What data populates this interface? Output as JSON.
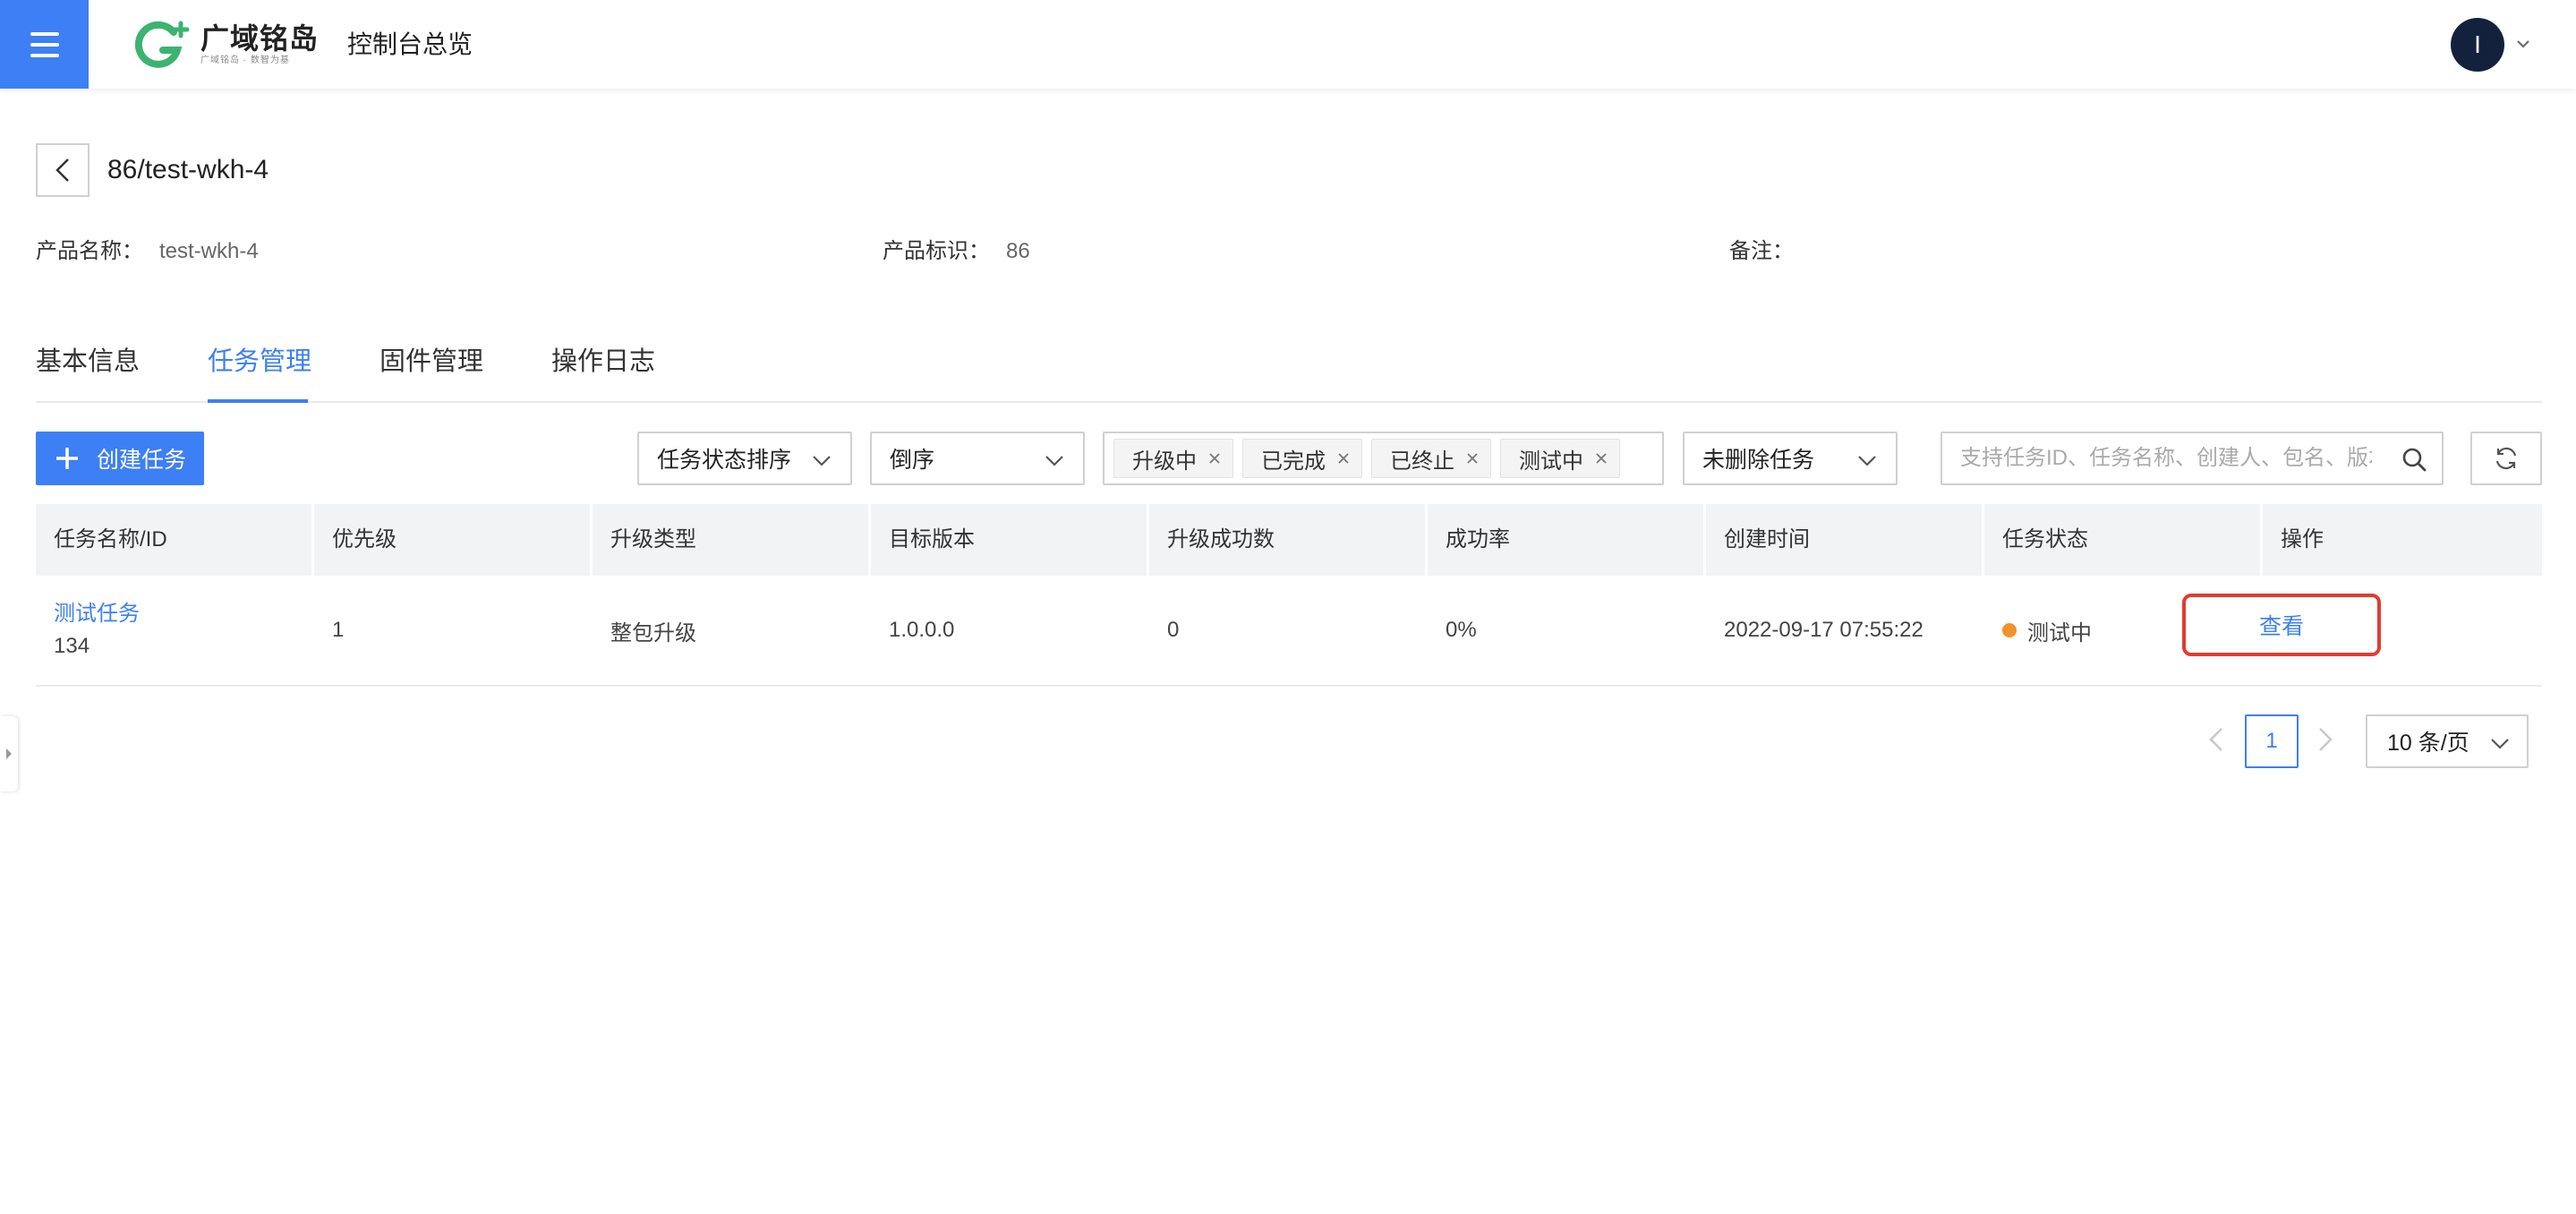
{
  "header": {
    "brand_name": "广域铭岛",
    "brand_tagline": "广域铭岛 · 数智为基",
    "console_title": "控制台总览",
    "avatar_letter": "I",
    "accent_color": "#3d7ff4"
  },
  "breadcrumb": {
    "title": "86/test-wkh-4"
  },
  "product_info": {
    "name_label": "产品名称：",
    "name_value": "test-wkh-4",
    "key_label": "产品标识：",
    "key_value": "86",
    "remark_label": "备注：",
    "remark_value": ""
  },
  "tabs": [
    {
      "label": "基本信息",
      "active": false
    },
    {
      "label": "任务管理",
      "active": true
    },
    {
      "label": "固件管理",
      "active": false
    },
    {
      "label": "操作日志",
      "active": false
    }
  ],
  "toolbar": {
    "create_label": "创建任务",
    "sort_field": "任务状态排序",
    "sort_order": "倒序",
    "status_tags": [
      "升级中",
      "已完成",
      "已终止",
      "测试中"
    ],
    "delete_filter": "未删除任务",
    "search_placeholder": "支持任务ID、任务名称、创建人、包名、版本"
  },
  "table": {
    "columns": [
      "任务名称/ID",
      "优先级",
      "升级类型",
      "目标版本",
      "升级成功数",
      "成功率",
      "创建时间",
      "任务状态",
      "操作"
    ],
    "rows": [
      {
        "task_name": "测试任务",
        "task_id": "134",
        "priority": "1",
        "upgrade_type": "整包升级",
        "target_version": "1.0.0.0",
        "success_count": "0",
        "success_rate": "0%",
        "created_at": "2022-09-17 07:55:22",
        "status": "测试中",
        "status_color": "#f0932b",
        "action": "查看"
      }
    ]
  },
  "pagination": {
    "current_page": "1",
    "page_size": "10 条/页"
  }
}
